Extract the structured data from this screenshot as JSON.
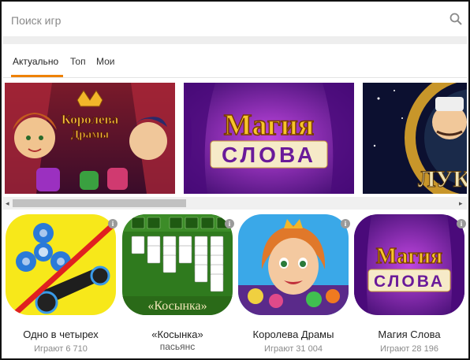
{
  "search": {
    "placeholder": "Поиск игр"
  },
  "tabs": [
    {
      "label": "Актуально",
      "active": true
    },
    {
      "label": "Топ",
      "active": false
    },
    {
      "label": "Мои",
      "active": false
    }
  ],
  "banners": [
    {
      "title_line1": "Королева",
      "title_line2": "Драмы"
    },
    {
      "title_line1": "Магия",
      "title_line2": "СЛОВА"
    },
    {
      "title_line1": "ЛУКОМО"
    }
  ],
  "scrollbar": {
    "left_arrow": "◂",
    "right_arrow": "▸"
  },
  "games": [
    {
      "name": "Одно в четырех",
      "players": "Играют 6 710"
    },
    {
      "name": "«Косынка»",
      "name_line2": "пасьянс",
      "art_text": "«Косынка»"
    },
    {
      "name": "Королева Драмы",
      "players": "Играют 31 004"
    },
    {
      "name": "Магия Слова",
      "players": "Играют 28 196",
      "art_line1": "Магия",
      "art_line2": "СЛОВА"
    }
  ],
  "info_glyph": "i",
  "colors": {
    "accent": "#ee8208",
    "magic_purple": "#6a1aa8",
    "magic_gold": "#f5c230",
    "solitaire_green": "#2f7a1e"
  }
}
